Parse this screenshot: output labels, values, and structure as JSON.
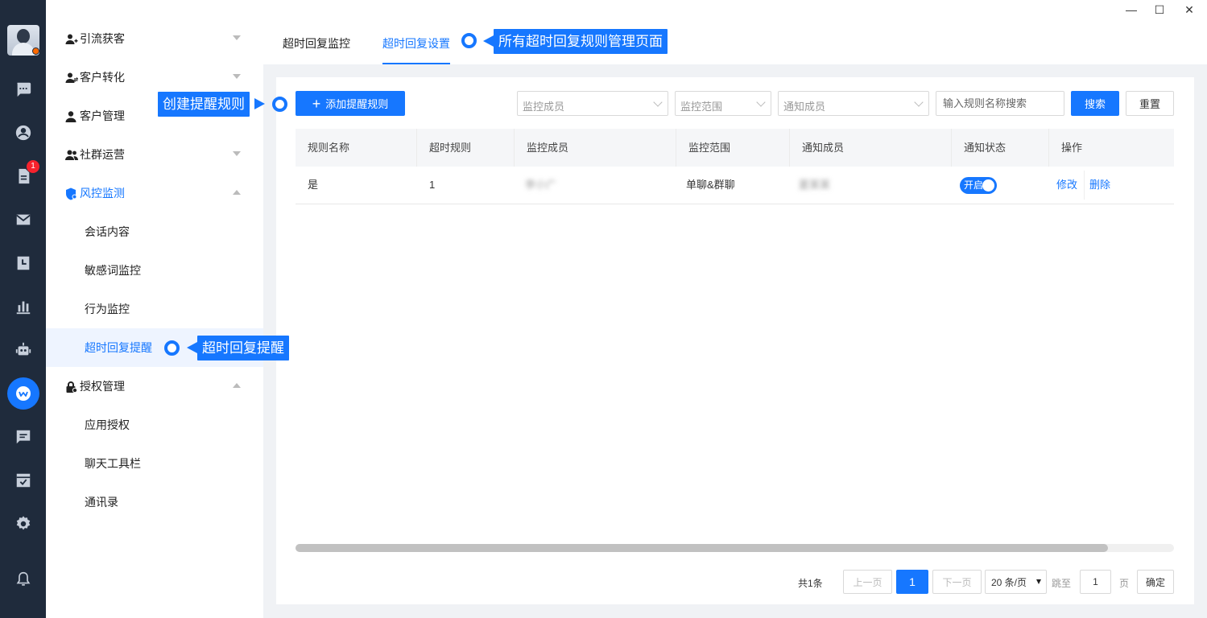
{
  "window": {
    "minimize": "—",
    "maximize": "☐",
    "close": "✕"
  },
  "rail": {
    "badge_count": "1",
    "accent_color": "#1677ff",
    "icons": [
      "chat-icon",
      "contact-icon",
      "task-icon",
      "mail-icon",
      "calendar-icon",
      "stats-icon",
      "robot-icon",
      "work-app-icon",
      "message-icon",
      "approval-icon",
      "settings-icon",
      "bell-icon"
    ]
  },
  "sidebar": {
    "groups": [
      {
        "label": "引流获客"
      },
      {
        "label": "客户转化"
      },
      {
        "label": "客户管理"
      },
      {
        "label": "社群运营"
      },
      {
        "label": "风控监测"
      },
      {
        "label": "授权管理"
      }
    ],
    "risk_items": [
      "会话内容",
      "敏感词监控",
      "行为监控",
      "超时回复提醒"
    ],
    "auth_items": [
      "应用授权",
      "聊天工具栏",
      "通讯录"
    ]
  },
  "tabs": [
    {
      "label": "超时回复监控"
    },
    {
      "label": "超时回复设置"
    }
  ],
  "toolbar": {
    "add_label": "添加提醒规则",
    "filter_monitor_member": "监控成员",
    "filter_monitor_scope": "监控范围",
    "filter_notify_member": "通知成员",
    "search_placeholder": "输入规则名称搜索",
    "search_label": "搜索",
    "reset_label": "重置"
  },
  "table": {
    "headers": [
      "规则名称",
      "超时规则",
      "监控成员",
      "监控范围",
      "通知成员",
      "通知状态",
      "操作"
    ],
    "rows": [
      {
        "name": "是",
        "timeout_rule": "1",
        "monitor_member": "李小广",
        "scope": "单聊&群聊",
        "notify_member": "夏某某",
        "status": "开启",
        "edit": "修改",
        "delete": "删除"
      }
    ]
  },
  "pagination": {
    "total": "共1条",
    "prev": "上一页",
    "current": "1",
    "next": "下一页",
    "page_size": "20 条/页",
    "jump_label": "跳至",
    "jump_value": "1",
    "page_unit": "页",
    "confirm": "确定"
  },
  "callouts": {
    "tab_note": "所有超时回复规则管理页面",
    "add_note": "创建提醒规则",
    "menu_note": "超时回复提醒"
  }
}
